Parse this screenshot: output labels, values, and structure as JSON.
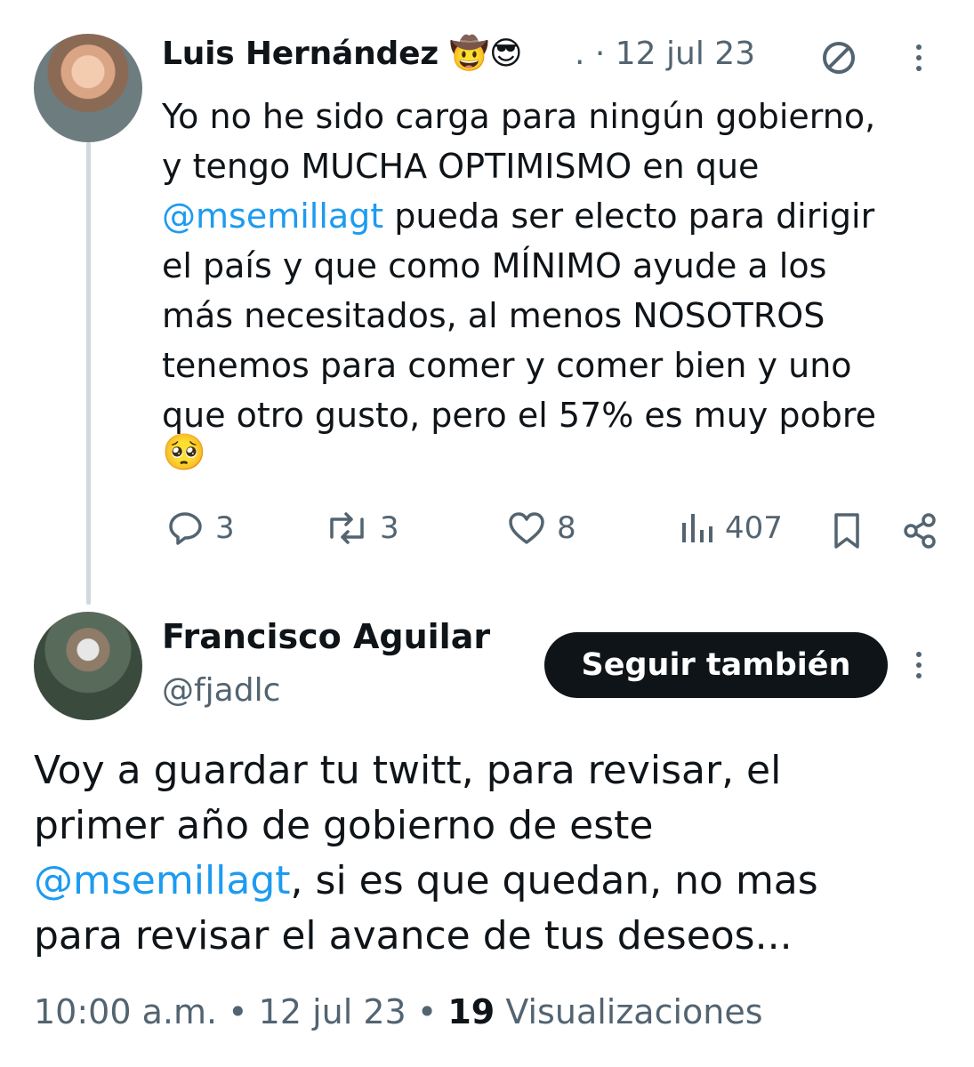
{
  "reply_parent": {
    "author_name": "Luis Hernández",
    "author_emojis": "🤠😎",
    "timestamp": ". · 12 jul 23",
    "text_lines": [
      "Yo no he sido carga para ningún gobierno,",
      "y tengo MUCHA OPTIMISMO en que",
      " pueda ser electo para dirigir",
      "el país y que como MÍNIMO ayude a los",
      "más necesitados, al menos NOSOTROS",
      "tenemos para comer y comer bien y uno",
      "que otro gusto, pero el 57% es muy pobre"
    ],
    "mention": "@msemillagt",
    "trailing_emoji": "🥺",
    "stats": {
      "replies": "3",
      "reposts": "3",
      "likes": "8",
      "views": "407"
    }
  },
  "main_tweet": {
    "author_name": "Francisco Aguilar",
    "handle": "@fjadlc",
    "follow_label": "Seguir también",
    "text_before_mention": "Voy a guardar tu twitt, para revisar, el\nprimer año de gobierno de este\n",
    "mention": "@msemillagt",
    "text_after_mention": ", si es que quedan, no mas\npara revisar el avance de tus deseos...",
    "time": "10:00 a.m.",
    "date": "12 jul 23",
    "views_count": "19",
    "views_label": "Visualizaciones"
  },
  "colors": {
    "text": "#0f1419",
    "secondary": "#536471",
    "link": "#1d9bf0",
    "thread_line": "#cfd9de",
    "button_bg": "#0f1419"
  },
  "icons": [
    "no-entry-icon",
    "kebab-icon",
    "reply-icon",
    "repost-icon",
    "like-icon",
    "views-icon",
    "bookmark-icon",
    "share-icon"
  ]
}
